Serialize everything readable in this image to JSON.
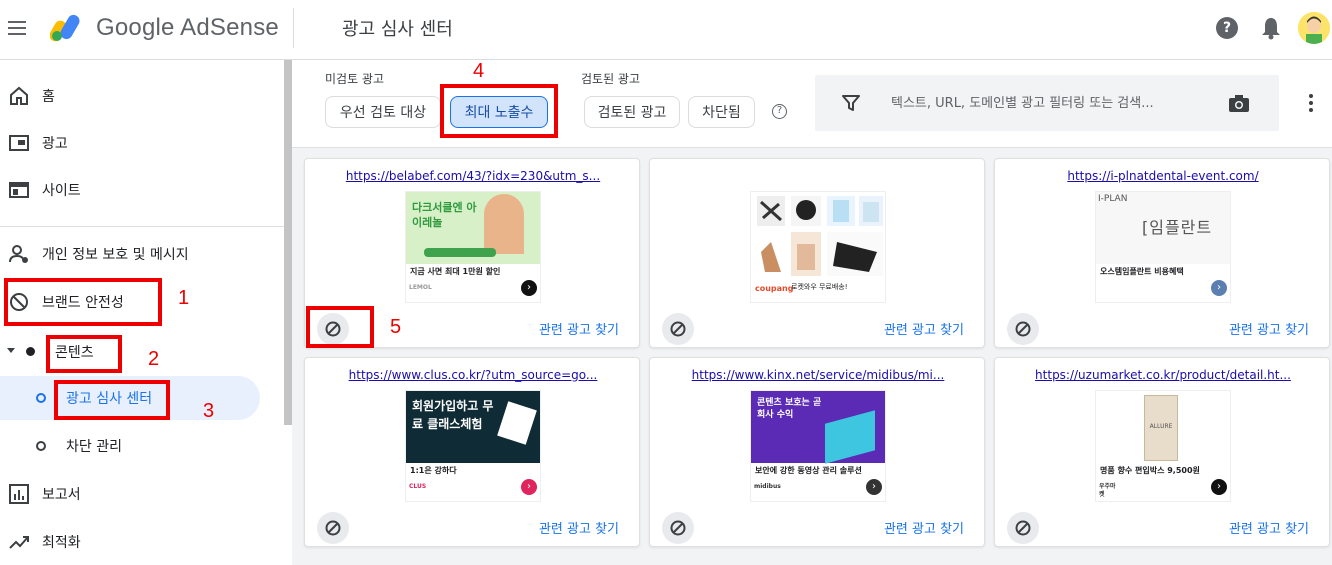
{
  "app": {
    "brand": "Google AdSense",
    "page_title": "광고 심사 센터"
  },
  "colors": {
    "accent": "#1a73e8",
    "annotation": "#ee0000",
    "selected_chip_bg": "#d2e3fc"
  },
  "sidebar": {
    "items": [
      {
        "label": "홈",
        "icon": "home-icon"
      },
      {
        "label": "광고",
        "icon": "ads-icon"
      },
      {
        "label": "사이트",
        "icon": "sites-icon"
      },
      {
        "label": "개인 정보 보호 및 메시지",
        "icon": "privacy-icon"
      },
      {
        "label": "브랜드 안전성",
        "icon": "block-icon"
      },
      {
        "label": "콘텐츠",
        "icon": "dot-icon"
      },
      {
        "label": "보고서",
        "icon": "reports-icon"
      },
      {
        "label": "최적화",
        "icon": "trend-icon"
      }
    ],
    "subitems": [
      {
        "label": "광고 심사 센터",
        "active": true
      },
      {
        "label": "차단 관리",
        "active": false
      }
    ]
  },
  "filters": {
    "unreviewed_label": "미검토 광고",
    "reviewed_label": "검토된 광고",
    "chips": {
      "priority": "우선 검토 대상",
      "max_impressions": "최대 노출수",
      "reviewed": "검토된 광고",
      "blocked": "차단됨"
    },
    "help": "?"
  },
  "search": {
    "placeholder": "텍스트, URL, 도메인별 광고 필터링 또는 검색..."
  },
  "cards": [
    {
      "url": "https://belabef.com/43/?idx=230&utm_s...",
      "headline": "지금 사면 최대 1만원 할인",
      "banner": "다크서클엔 아이레놀",
      "logo": "LEMOL",
      "related": "관련 광고 찾기"
    },
    {
      "url": "",
      "headline": "로켓와우 무료배송!",
      "banner": "",
      "logo": "coupang",
      "related": "관련 광고 찾기"
    },
    {
      "url": "https://i-plnatdental-event.com/",
      "headline": "오스템임플란트 비용혜택",
      "banner": "[임플란트",
      "logo": "I-PLAN",
      "related": "관련 광고 찾기"
    },
    {
      "url": "https://www.clus.co.kr/?utm_source=go...",
      "headline": "1:1은 강하다",
      "banner": "회원가입하고 무료 클래스체험",
      "logo": "CLUS",
      "related": "관련 광고 찾기"
    },
    {
      "url": "https://www.kinx.net/service/midibus/mi...",
      "headline": "보안에 강한 동영상 관리 솔루션",
      "banner": "콘텐츠 보호는 곧 회사 수익",
      "logo": "midibus",
      "related": "관련 광고 찾기"
    },
    {
      "url": "https://uzumarket.co.kr/product/detail.ht...",
      "headline": "명품 향수 편입박스 9,500원",
      "banner": "ALLURE",
      "logo": "우주마켓",
      "related": "관련 광고 찾기"
    }
  ],
  "annotations": [
    "1",
    "2",
    "3",
    "4",
    "5"
  ]
}
